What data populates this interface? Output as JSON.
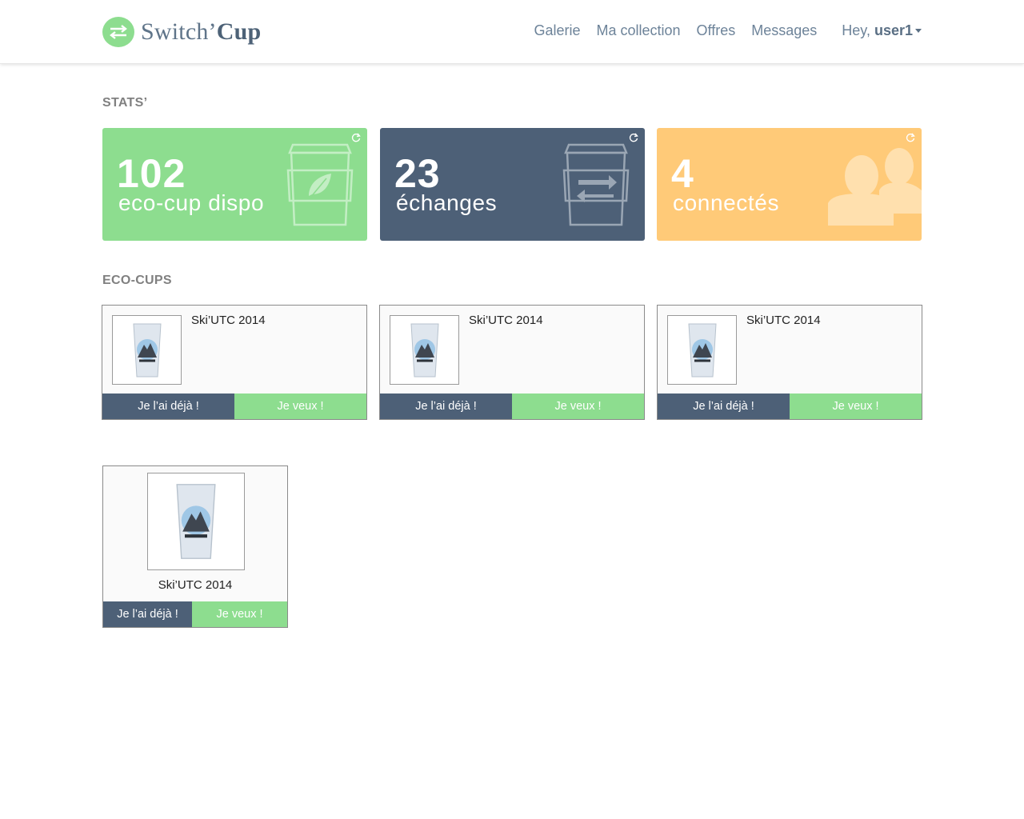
{
  "header": {
    "brand_light": "Switch’",
    "brand_bold": "Cup",
    "nav": [
      "Galerie",
      "Ma collection",
      "Offres",
      "Messages"
    ],
    "greeting": "Hey,",
    "username": "user1"
  },
  "stats": {
    "title": "STATS’",
    "cards": [
      {
        "number": "102",
        "label": "eco-cup dispo"
      },
      {
        "number": "23",
        "label": "échanges"
      },
      {
        "number": "4",
        "label": "connectés"
      }
    ]
  },
  "ecocups": {
    "title": "ECO-CUPS",
    "items": [
      {
        "name": "Ski’UTC 2014",
        "have_label": "Je l’ai déjà !",
        "want_label": "Je veux !"
      },
      {
        "name": "Ski’UTC 2014",
        "have_label": "Je l’ai déjà !",
        "want_label": "Je veux !"
      },
      {
        "name": "Ski’UTC 2014",
        "have_label": "Je l’ai déjà !",
        "want_label": "Je veux !"
      },
      {
        "name": "Ski’UTC 2014",
        "have_label": "Je l’ai déjà !",
        "want_label": "Je veux !"
      }
    ]
  },
  "colors": {
    "green": "#8ddd8f",
    "slate": "#4d6077",
    "orange": "#ffca78"
  }
}
